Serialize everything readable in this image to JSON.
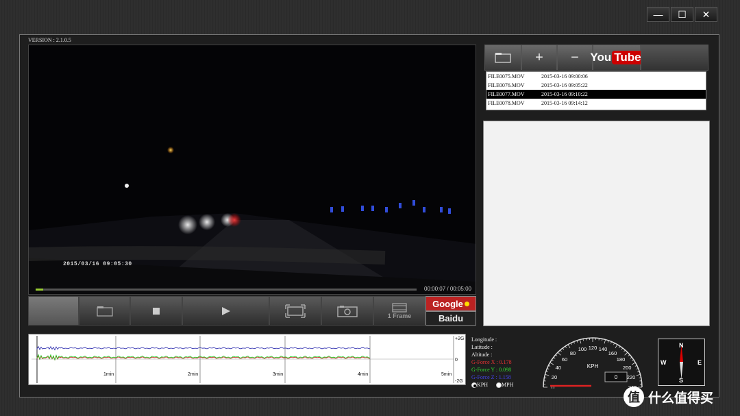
{
  "window": {
    "minimize_label": "—",
    "maximize_label": "☐",
    "close_label": "✕"
  },
  "version": "VERSION : 2.1.0.5",
  "video": {
    "timestamp_overlay": "2015/03/16 09:05:30",
    "elapsed": "00:00:07",
    "total": "00:05:00",
    "time_display": "00:00:07 / 00:05:00",
    "progress": 0.02
  },
  "controls": {
    "frame_label": "1 Frame"
  },
  "maps": {
    "google": "Google",
    "baidu": "Baidu"
  },
  "file_toolbar": {
    "add_label": "+",
    "remove_label": "−",
    "youtube_you": "You",
    "youtube_tube": "Tube"
  },
  "files": [
    {
      "name": "FILE0075.MOV",
      "date": "2015-03-16 09:00:06",
      "selected": false
    },
    {
      "name": "FILE0076.MOV",
      "date": "2015-03-16 09:05:22",
      "selected": false
    },
    {
      "name": "FILE0077.MOV",
      "date": "2015-03-16 09:10:22",
      "selected": true
    },
    {
      "name": "FILE0078.MOV",
      "date": "2015-03-16 09:14:12",
      "selected": false
    }
  ],
  "graph": {
    "y_labels": [
      "+2G",
      "0",
      "-2G"
    ],
    "x_labels": [
      "1min",
      "2min",
      "3min",
      "4min",
      "5min"
    ],
    "colors": {
      "x": "#cc2222",
      "y": "#22cc22",
      "z": "#2222aa"
    }
  },
  "readout": {
    "longitude": "Longitude :",
    "latitude": "Latitude  :",
    "altitude": "Altitude  :",
    "gx": "G-Force X : 0.178",
    "gy": "G-Force Y : 0.098",
    "gz": "G-Force Z : 1.158"
  },
  "units": {
    "kph": "KPH",
    "mph": "MPH"
  },
  "speedometer": {
    "unit": "KPH",
    "speed": "0",
    "ticks": [
      "0",
      "20",
      "40",
      "60",
      "80",
      "100",
      "120",
      "140",
      "160",
      "180",
      "200",
      "220",
      "240"
    ]
  },
  "compass": {
    "n": "N",
    "s": "S",
    "e": "E",
    "w": "W"
  },
  "watermark": {
    "text": "什么值得买",
    "badge": "值"
  }
}
